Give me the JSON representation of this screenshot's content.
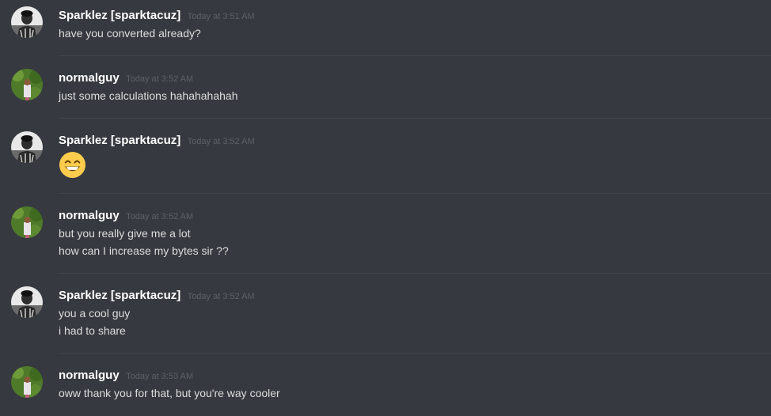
{
  "channel": {
    "messages": [
      {
        "author": "Sparklez [sparktacuz]",
        "timestamp": "Today at 3:51 AM",
        "lines": [
          "have you converted already?"
        ],
        "avatar": "sparklez-avatar"
      },
      {
        "author": "normalguy",
        "timestamp": "Today at 3:52 AM",
        "lines": [
          "just some calculations hahahahahah"
        ],
        "avatar": "normalguy-avatar"
      },
      {
        "author": "Sparklez [sparktacuz]",
        "timestamp": "Today at 3:52 AM",
        "lines": [],
        "emoji": "grinning-face-with-smiling-eyes-icon",
        "avatar": "sparklez-avatar"
      },
      {
        "author": "normalguy",
        "timestamp": "Today at 3:52 AM",
        "lines": [
          "but you really give me a lot",
          "how can I increase my bytes sir ??"
        ],
        "avatar": "normalguy-avatar"
      },
      {
        "author": "Sparklez [sparktacuz]",
        "timestamp": "Today at 3:52 AM",
        "lines": [
          "you a cool guy",
          "i had to share"
        ],
        "avatar": "sparklez-avatar"
      },
      {
        "author": "normalguy",
        "timestamp": "Today at 3:53 AM",
        "lines": [
          "oww thank you for that, but you're way cooler"
        ],
        "avatar": "normalguy-avatar"
      }
    ]
  },
  "colors": {
    "background": "#36393f",
    "username": "#ffffff",
    "timestamp": "#5d6066",
    "text": "#dcddde",
    "divider": "#42454a"
  }
}
